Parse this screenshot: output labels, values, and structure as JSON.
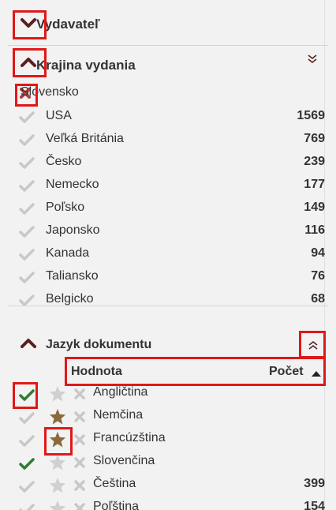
{
  "sections": {
    "publisher": {
      "title": "Vydavateľ",
      "state": "collapsed"
    },
    "country": {
      "title": "Krajina vydania",
      "state": "expanded",
      "selected": "Slovensko",
      "items": [
        {
          "label": "USA",
          "count": "1569"
        },
        {
          "label": "Veľká Británia",
          "count": "769"
        },
        {
          "label": "Česko",
          "count": "239"
        },
        {
          "label": "Nemecko",
          "count": "177"
        },
        {
          "label": "Poľsko",
          "count": "149"
        },
        {
          "label": "Japonsko",
          "count": "116"
        },
        {
          "label": "Kanada",
          "count": "94"
        },
        {
          "label": "Taliansko",
          "count": "76"
        },
        {
          "label": "Belgicko",
          "count": "68"
        }
      ]
    },
    "language": {
      "title": "Jazyk dokumentu",
      "state": "expanded",
      "header": {
        "value_label": "Hodnota",
        "count_label": "Počet"
      },
      "items": [
        {
          "label": "Angličtina",
          "count": "",
          "checked": true,
          "starred": false
        },
        {
          "label": "Nemčina",
          "count": "",
          "checked": false,
          "starred": true
        },
        {
          "label": "Francúzština",
          "count": "",
          "checked": false,
          "starred": true
        },
        {
          "label": "Slovenčina",
          "count": "",
          "checked": true,
          "starred": false
        },
        {
          "label": "Čeština",
          "count": "399",
          "checked": false,
          "starred": false
        },
        {
          "label": "Poľština",
          "count": "154",
          "checked": false,
          "starred": false
        }
      ]
    }
  },
  "colors": {
    "chevron": "#5a1f1f",
    "remove": "#b53a3a",
    "check_on": "#2e7d32",
    "check_off": "#c8c8c8",
    "star_on": "#8b6a3e",
    "star_off": "#d0d0d0",
    "highlight": "#e01818"
  },
  "icons": [
    "chevron-down-icon",
    "chevron-up-icon",
    "double-chevron-down-icon",
    "double-chevron-up-icon",
    "remove-icon",
    "check-icon",
    "star-icon",
    "exclude-icon",
    "sort-asc-icon"
  ]
}
